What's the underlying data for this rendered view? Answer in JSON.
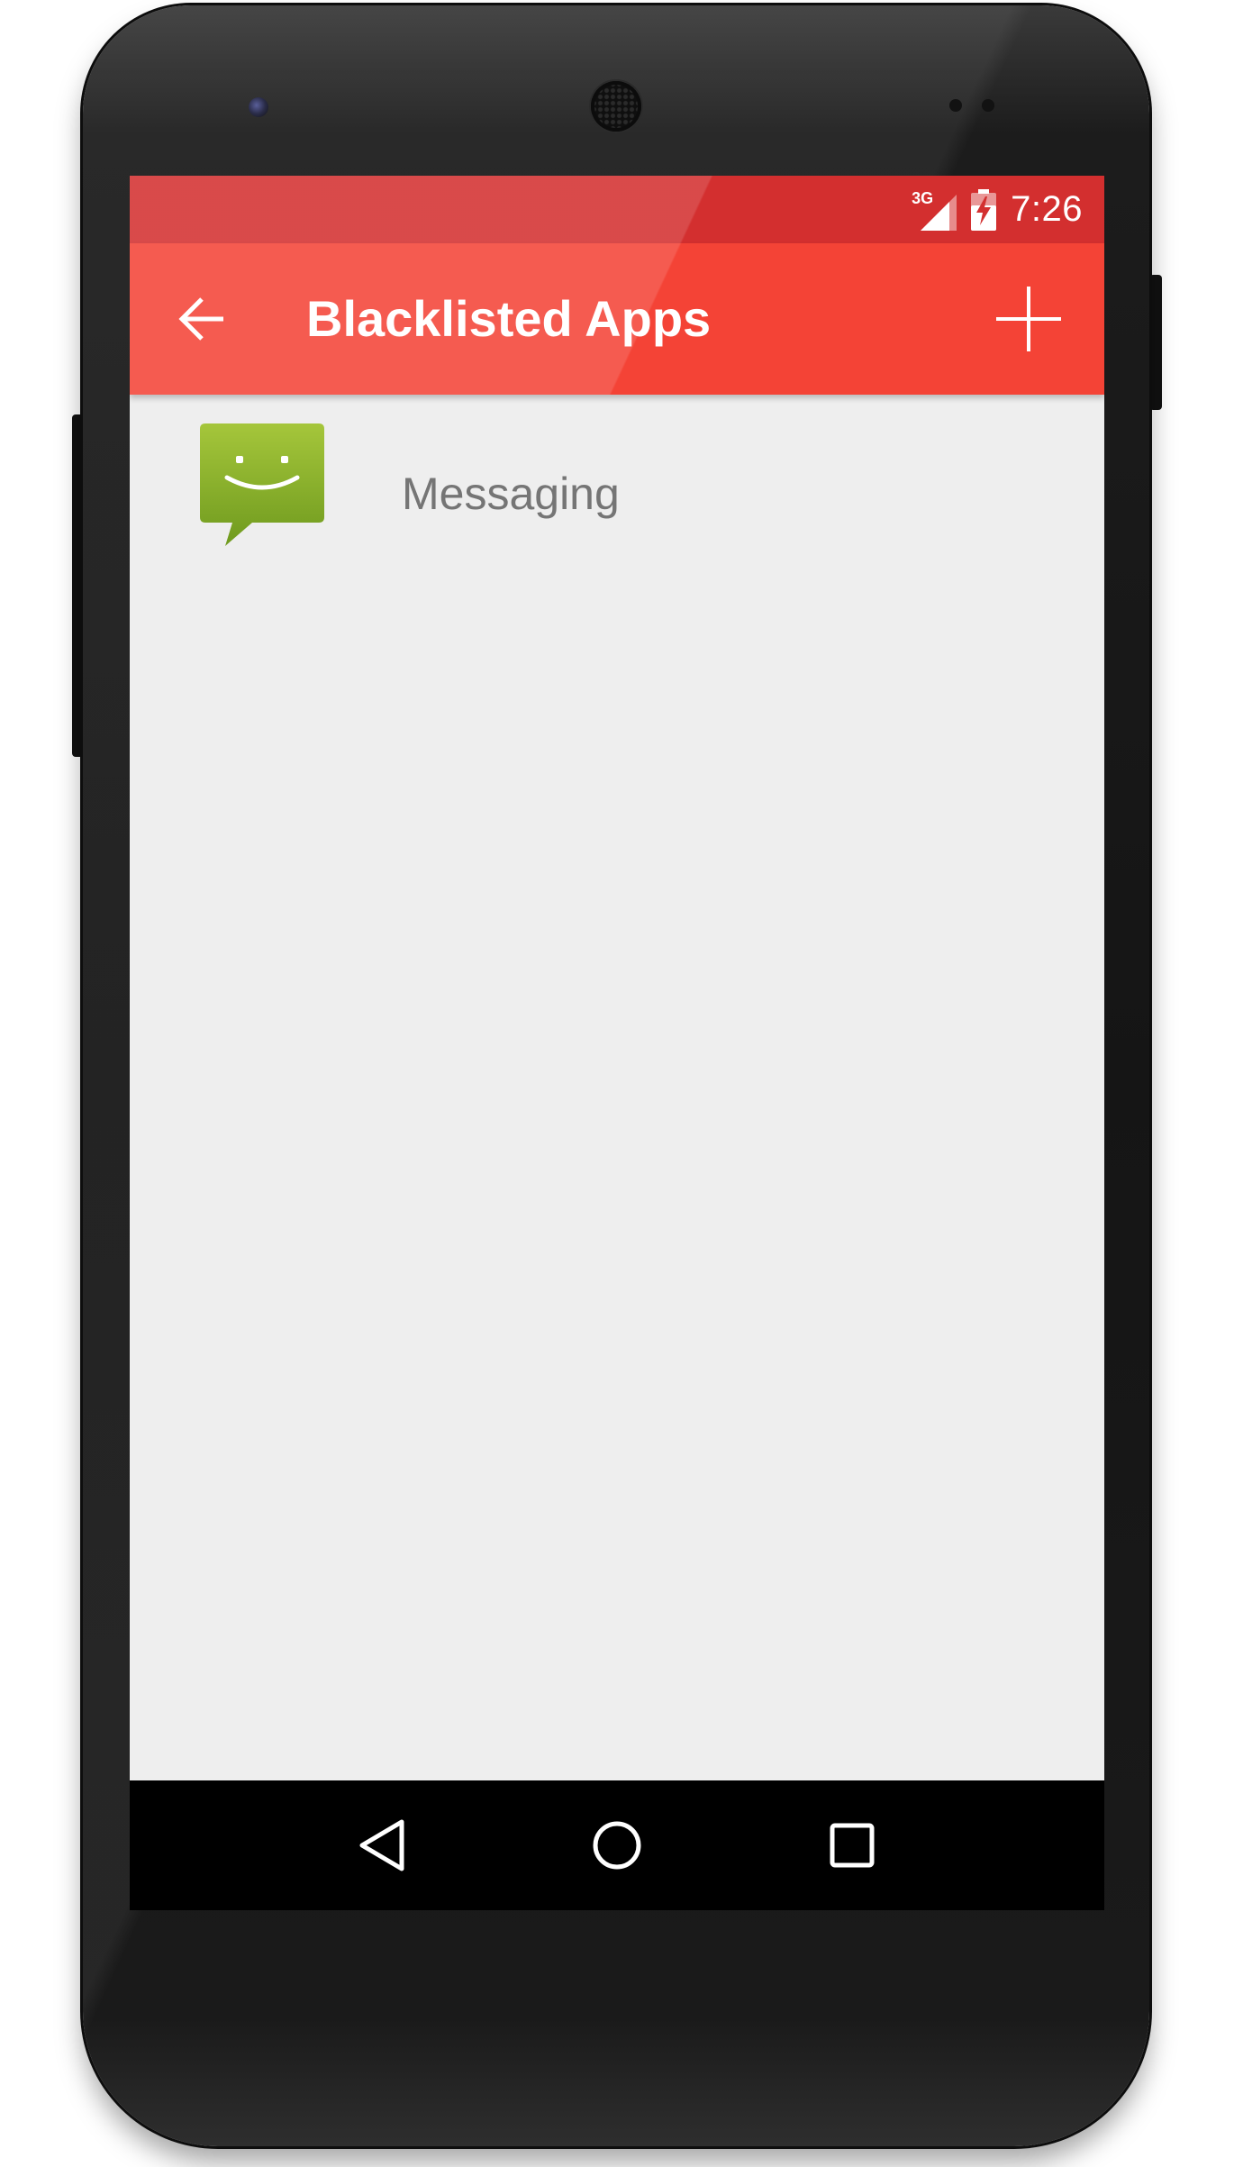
{
  "status_bar": {
    "network_type": "3G",
    "time": "7:26",
    "icons": [
      "signal-icon",
      "battery-charging-icon"
    ],
    "color": "#d32f2f"
  },
  "app_bar": {
    "title": "Blacklisted Apps",
    "back_icon": "arrow-back-icon",
    "add_icon": "plus-icon",
    "color": "#f44336"
  },
  "list": {
    "items": [
      {
        "label": "Messaging",
        "icon": "messaging-app-icon",
        "icon_color": "#8bb52b"
      }
    ]
  },
  "nav_bar": {
    "icons": [
      "back-triangle-icon",
      "home-circle-icon",
      "recents-square-icon"
    ]
  },
  "colors": {
    "background": "#eeeeee",
    "text_secondary": "#757575"
  }
}
